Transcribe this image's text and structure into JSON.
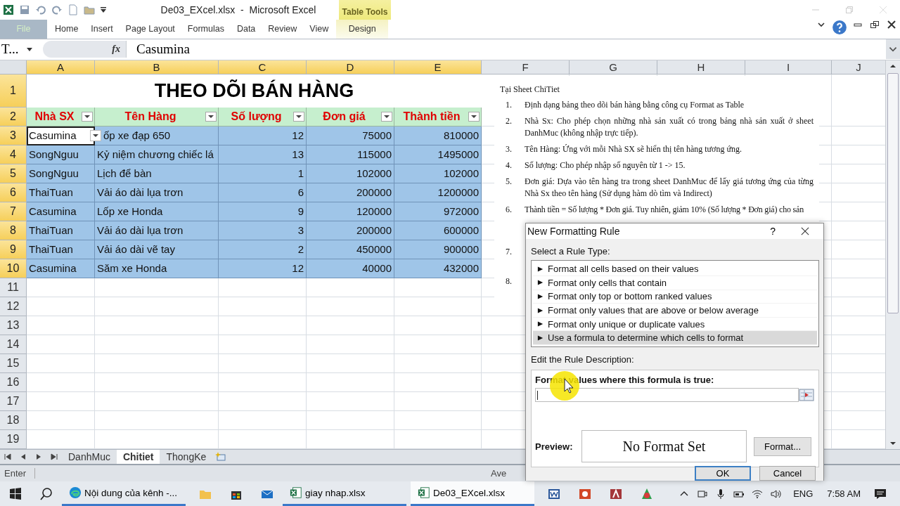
{
  "window": {
    "title": "De03_EXcel.xlsx  -  Microsoft Excel",
    "contextual_group": "Table Tools"
  },
  "ribbon_tabs": [
    {
      "label": "File",
      "kind": "file",
      "selected": false
    },
    {
      "label": "Home",
      "kind": "normal",
      "selected": false
    },
    {
      "label": "Insert",
      "kind": "normal",
      "selected": false
    },
    {
      "label": "Page Layout",
      "kind": "normal",
      "selected": false
    },
    {
      "label": "Formulas",
      "kind": "normal",
      "selected": false
    },
    {
      "label": "Data",
      "kind": "normal",
      "selected": false
    },
    {
      "label": "Review",
      "kind": "normal",
      "selected": false
    },
    {
      "label": "View",
      "kind": "normal",
      "selected": false
    },
    {
      "label": "Design",
      "kind": "contextual",
      "selected": false
    }
  ],
  "formula_bar": {
    "name_box": "T...",
    "function_label": "fx",
    "value": "Casumina"
  },
  "sheet": {
    "columns": [
      {
        "label": "A",
        "selected": true
      },
      {
        "label": "B",
        "selected": true
      },
      {
        "label": "C",
        "selected": true
      },
      {
        "label": "D",
        "selected": true
      },
      {
        "label": "E",
        "selected": true
      },
      {
        "label": "F",
        "selected": false
      },
      {
        "label": "G",
        "selected": false
      },
      {
        "label": "H",
        "selected": false
      },
      {
        "label": "I",
        "selected": false
      },
      {
        "label": "J",
        "selected": false
      }
    ],
    "rows": [
      {
        "label": "1",
        "selected": true
      },
      {
        "label": "2",
        "selected": true
      },
      {
        "label": "3",
        "selected": true
      },
      {
        "label": "4",
        "selected": true
      },
      {
        "label": "5",
        "selected": true
      },
      {
        "label": "6",
        "selected": true
      },
      {
        "label": "7",
        "selected": true
      },
      {
        "label": "8",
        "selected": true
      },
      {
        "label": "9",
        "selected": true
      },
      {
        "label": "10",
        "selected": true
      },
      {
        "label": "11",
        "selected": false
      },
      {
        "label": "12",
        "selected": false
      },
      {
        "label": "13",
        "selected": false
      },
      {
        "label": "14",
        "selected": false
      },
      {
        "label": "15",
        "selected": false
      },
      {
        "label": "16",
        "selected": false
      },
      {
        "label": "17",
        "selected": false
      },
      {
        "label": "18",
        "selected": false
      },
      {
        "label": "19",
        "selected": false
      }
    ],
    "title": "THEO DÕI BÁN HÀNG",
    "headers": [
      "Nhà SX",
      "Tên Hàng",
      "Số lượng",
      "Đơn giá",
      "Thành tiền"
    ],
    "data": [
      {
        "cells": [
          "Casumina",
          "ốp xe đạp 650",
          "12",
          "75000",
          "810000"
        ],
        "selected": true
      },
      {
        "cells": [
          "SongNguu",
          "Kỷ niệm chương chiếc lá",
          "13",
          "115000",
          "1495000"
        ],
        "selected": false
      },
      {
        "cells": [
          "SongNguu",
          "Lịch để bàn",
          "1",
          "102000",
          "102000"
        ],
        "selected": false
      },
      {
        "cells": [
          "ThaiTuan",
          "Vải áo dài lụa trơn",
          "6",
          "200000",
          "1200000"
        ],
        "selected": false
      },
      {
        "cells": [
          "Casumina",
          "Lốp xe Honda",
          "9",
          "120000",
          "972000"
        ],
        "selected": false
      },
      {
        "cells": [
          "ThaiTuan",
          "Vải áo dài lụa trơn",
          "3",
          "200000",
          "600000"
        ],
        "selected": false
      },
      {
        "cells": [
          "ThaiTuan",
          "Vải áo dài vẽ tay",
          "2",
          "450000",
          "900000"
        ],
        "selected": false
      },
      {
        "cells": [
          "Casumina",
          "Săm xe Honda",
          "12",
          "40000",
          "432000"
        ],
        "selected": false
      }
    ]
  },
  "notes": {
    "heading": "Tại Sheet ChiTiet",
    "items": [
      {
        "number": "1.",
        "text": "Định dạng bảng theo dõi bán hàng bằng công cụ Format as Table"
      },
      {
        "number": "2.",
        "text": "Nhà Sx: Cho phép chọn những nhà sản xuất có trong bảng nhà sản xuất ở sheet DanhMuc (không nhập trực tiếp)."
      },
      {
        "number": "3.",
        "text": "Tên Hàng: Ứng với mỗi Nhà SX sẽ hiển thị tên hàng tương ứng."
      },
      {
        "number": "4.",
        "text": "Số lượng: Cho phép nhập số nguyên từ 1 -> 15."
      },
      {
        "number": "5.",
        "text": "Đơn giá: Dựa vào tên hàng tra trong sheet DanhMuc để lấy giá tương ứng của từng Nhà Sx theo tên hàng (Sử dụng hàm dò tìm và Indirect)"
      },
      {
        "number": "6.",
        "text": "Thành tiền = Số lượng * Đơn giá. Tuy nhiên, giảm 10% (Số lượng * Đơn giá) cho sản"
      },
      {
        "number": "7."
      },
      {
        "number": "8."
      }
    ]
  },
  "sheet_tabs": [
    {
      "label": "DanhMuc",
      "selected": false
    },
    {
      "label": "Chitiet",
      "selected": true
    },
    {
      "label": "ThongKe",
      "selected": false
    }
  ],
  "status_bar": {
    "mode": "Enter",
    "summary": "Ave"
  },
  "dialog": {
    "title": "New Formatting Rule",
    "help": "?",
    "rule_type_label": "Select a Rule Type:",
    "rule_types": [
      {
        "label": "Format all cells based on their values",
        "selected": false
      },
      {
        "label": "Format only cells that contain",
        "selected": false
      },
      {
        "label": "Format only top or bottom ranked values",
        "selected": false
      },
      {
        "label": "Format only values that are above or below average",
        "selected": false
      },
      {
        "label": "Format only unique or duplicate values",
        "selected": false
      },
      {
        "label": "Use a formula to determine which cells to format",
        "selected": true
      }
    ],
    "description_label": "Edit the Rule Description:",
    "formula_label": "Format values where this formula is true:",
    "preview_label": "Preview:",
    "preview_text": "No Format Set",
    "format_button": "Format...",
    "ok": "OK",
    "cancel": "Cancel"
  },
  "taskbar": {
    "items": [
      {
        "kind": "edge",
        "label": "Nội dung của kênh -...",
        "selected": false
      },
      {
        "kind": "explorer",
        "selected": false
      },
      {
        "kind": "store",
        "selected": false
      },
      {
        "kind": "mail",
        "selected": false
      },
      {
        "kind": "excel",
        "label": "giay nhap.xlsx",
        "selected": false
      },
      {
        "kind": "excel",
        "label": "De03_EXcel.xlsx",
        "selected": true
      },
      {
        "kind": "word",
        "selected": false
      },
      {
        "kind": "powerpoint",
        "selected": false
      },
      {
        "kind": "access",
        "selected": false
      },
      {
        "kind": "app",
        "selected": false
      }
    ],
    "language": "ENG",
    "time": "7:58 AM"
  }
}
